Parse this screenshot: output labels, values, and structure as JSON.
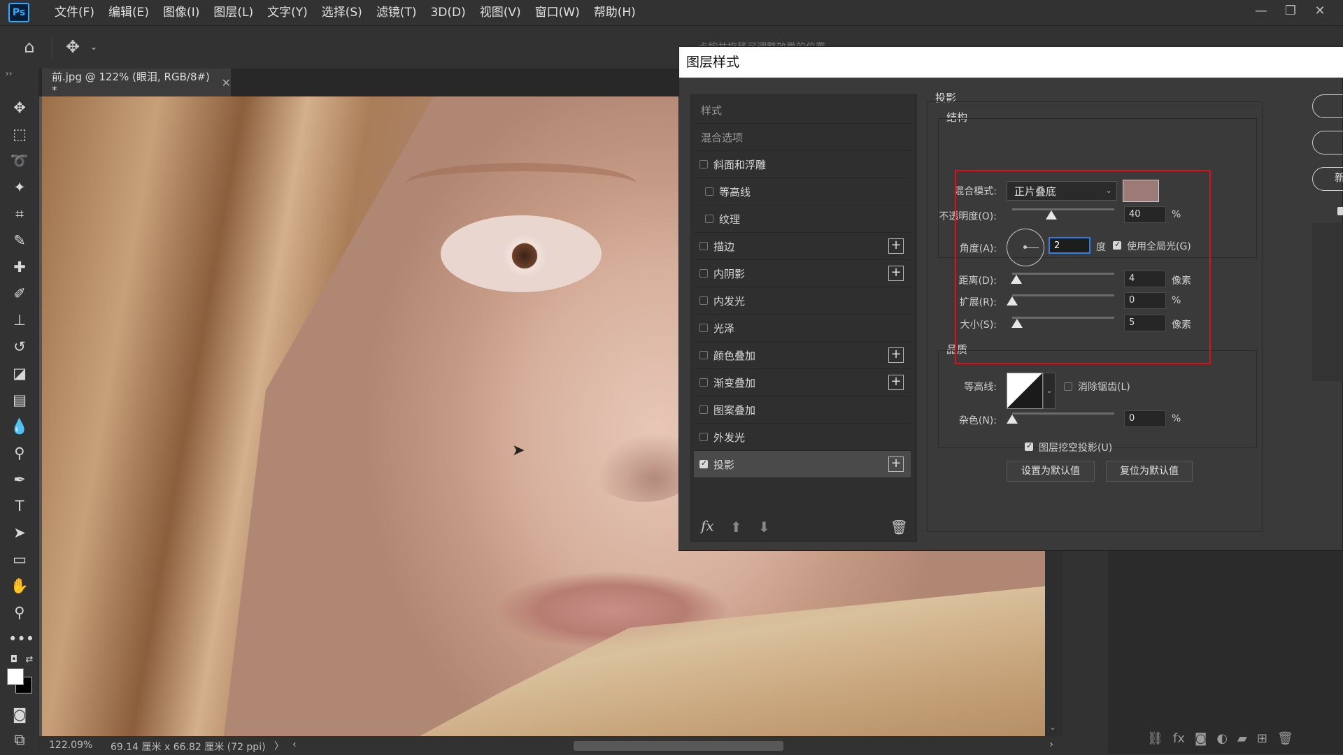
{
  "app": {
    "logo": "Ps",
    "menu": [
      "文件(F)",
      "编辑(E)",
      "图像(I)",
      "图层(L)",
      "文字(Y)",
      "选择(S)",
      "滤镜(T)",
      "3D(D)",
      "视图(V)",
      "窗口(W)",
      "帮助(H)"
    ],
    "window_controls": [
      "—",
      "❐",
      "✕"
    ]
  },
  "options_bar": {
    "hint": "点按并拖移可调整效果的位置"
  },
  "document": {
    "tab_title": "前.jpg @ 122% (眼泪, RGB/8#) *",
    "tab_close": "✕"
  },
  "status": {
    "zoom": "122.09%",
    "doc_size": "69.14 厘米 x 66.82 厘米 (72 ppi)",
    "arrow": "〉",
    "left": "‹",
    "right": "›"
  },
  "dialog": {
    "title": "图层样式",
    "list": {
      "header_styles": "样式",
      "header_blend": "混合选项",
      "items": [
        {
          "label": "斜面和浮雕",
          "checked": false,
          "indent": false,
          "plus": false
        },
        {
          "label": "等高线",
          "checked": false,
          "indent": true,
          "plus": false
        },
        {
          "label": "纹理",
          "checked": false,
          "indent": true,
          "plus": false
        },
        {
          "label": "描边",
          "checked": false,
          "indent": false,
          "plus": true
        },
        {
          "label": "内阴影",
          "checked": false,
          "indent": false,
          "plus": true
        },
        {
          "label": "内发光",
          "checked": false,
          "indent": false,
          "plus": false
        },
        {
          "label": "光泽",
          "checked": false,
          "indent": false,
          "plus": false
        },
        {
          "label": "颜色叠加",
          "checked": false,
          "indent": false,
          "plus": true
        },
        {
          "label": "渐变叠加",
          "checked": false,
          "indent": false,
          "plus": true
        },
        {
          "label": "图案叠加",
          "checked": false,
          "indent": false,
          "plus": false
        },
        {
          "label": "外发光",
          "checked": false,
          "indent": false,
          "plus": false
        },
        {
          "label": "投影",
          "checked": true,
          "indent": false,
          "plus": true,
          "active": true
        }
      ],
      "footer": {
        "fx": "fx",
        "up": "⬆",
        "down": "⬇",
        "trash": "🗑"
      }
    },
    "drop_shadow": {
      "section_title": "投影",
      "structure_title": "结构",
      "blend_mode_label": "混合模式:",
      "blend_mode_value": "正片叠底",
      "shadow_color": "#9c7b76",
      "opacity_label": "不透明度(O):",
      "opacity_value": "40",
      "opacity_unit": "%",
      "angle_label": "角度(A):",
      "angle_value": "2",
      "angle_unit": "度",
      "use_global_light_label": "使用全局光(G)",
      "use_global_light": true,
      "distance_label": "距离(D):",
      "distance_value": "4",
      "distance_unit": "像素",
      "spread_label": "扩展(R):",
      "spread_value": "0",
      "spread_unit": "%",
      "size_label": "大小(S):",
      "size_value": "5",
      "size_unit": "像素",
      "quality_title": "品质",
      "contour_label": "等高线:",
      "anti_alias_label": "消除锯齿(L)",
      "anti_alias": false,
      "noise_label": "杂色(N):",
      "noise_value": "0",
      "noise_unit": "%",
      "knockout_label": "图层挖空投影(U)",
      "knockout": true,
      "make_default": "设置为默认值",
      "reset_default": "复位为默认值"
    },
    "side": {
      "new_label": "新"
    }
  },
  "colors": {
    "highlight": "#e0101a",
    "accent": "#2f7ee8"
  }
}
